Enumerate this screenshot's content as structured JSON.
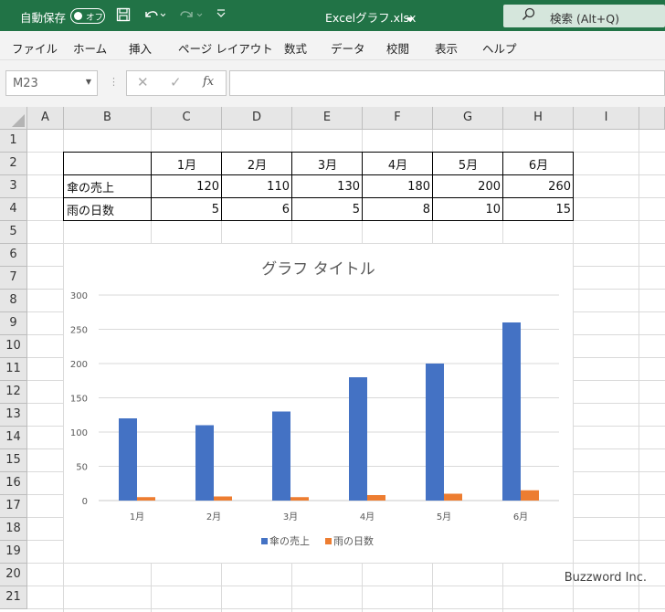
{
  "titlebar": {
    "autosave_label": "自動保存",
    "autosave_state": "オフ",
    "filename": "Excelグラフ.xlsx",
    "search_placeholder": "検索 (Alt+Q)"
  },
  "menu": [
    "ファイル",
    "ホーム",
    "挿入",
    "ページ レイアウト",
    "数式",
    "データ",
    "校閲",
    "表示",
    "ヘルプ"
  ],
  "formula_bar": {
    "name_box": "M23",
    "function_icon": "fx",
    "formula": ""
  },
  "columns": [
    "A",
    "B",
    "C",
    "D",
    "E",
    "F",
    "G",
    "H",
    "I"
  ],
  "rows": [
    "1",
    "2",
    "3",
    "4",
    "5",
    "6",
    "7",
    "8",
    "9",
    "10",
    "11",
    "12",
    "13",
    "14",
    "15",
    "16",
    "17",
    "18",
    "19",
    "20",
    "21"
  ],
  "table": {
    "headers": [
      "",
      "1月",
      "2月",
      "3月",
      "4月",
      "5月",
      "6月"
    ],
    "rows": [
      [
        "傘の売上",
        "120",
        "110",
        "130",
        "180",
        "200",
        "260"
      ],
      [
        "雨の日数",
        "5",
        "6",
        "5",
        "8",
        "10",
        "15"
      ]
    ]
  },
  "chart_data": {
    "type": "bar",
    "title": "グラフ タイトル",
    "categories": [
      "1月",
      "2月",
      "3月",
      "4月",
      "5月",
      "6月"
    ],
    "series": [
      {
        "name": "傘の売上",
        "values": [
          120,
          110,
          130,
          180,
          200,
          260
        ],
        "color": "#4472c4"
      },
      {
        "name": "雨の日数",
        "values": [
          5,
          6,
          5,
          8,
          10,
          15
        ],
        "color": "#ed7d31"
      }
    ],
    "ylim": [
      0,
      300
    ],
    "yticks": [
      "0",
      "50",
      "100",
      "150",
      "200",
      "250",
      "300"
    ],
    "grid": true,
    "legend": "bottom"
  },
  "watermark": "Buzzword Inc."
}
